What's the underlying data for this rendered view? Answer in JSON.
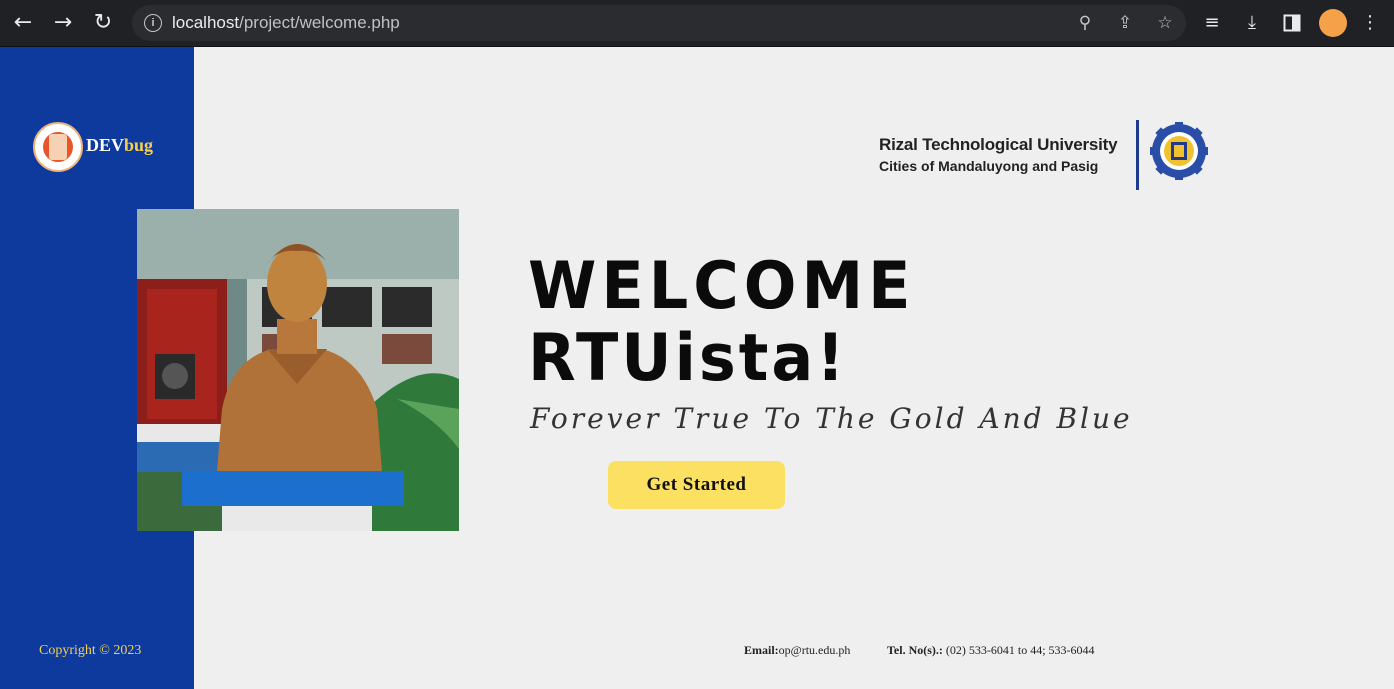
{
  "browser": {
    "url_host": "localhost",
    "url_path": "/project/welcome.php",
    "icons": {
      "back": "arrow-left-icon",
      "forward": "arrow-right-icon",
      "reload": "reload-icon",
      "site_info": "info-icon",
      "zoom": "zoom-icon",
      "share": "share-icon",
      "bookmark": "star-icon",
      "media": "playlist-icon",
      "download": "download-icon",
      "side_panel": "side-panel-icon",
      "menu": "kebab-menu-icon"
    },
    "avatar_color": "#f4a14a"
  },
  "sidebar": {
    "brand_prefix": "DEV",
    "brand_suffix": "bug",
    "copyright": "Copyright © 2023",
    "background": "#0d3a9c",
    "accent": "#f6d04d"
  },
  "university": {
    "name": "Rizal Technological University",
    "subtitle": "Cities of Mandaluyong and Pasig"
  },
  "hero": {
    "line1": "WELCOME",
    "line2": "RTUista!",
    "tagline": "Forever True To The Gold And Blue",
    "cta_label": "Get Started",
    "cta_color": "#fbe062"
  },
  "footer": {
    "email_label": "Email:",
    "email_value": "op@rtu.edu.ph",
    "tel_label": "Tel. No(s).:",
    "tel_value": "(02) 533-6041 to 44; 533-6044"
  }
}
